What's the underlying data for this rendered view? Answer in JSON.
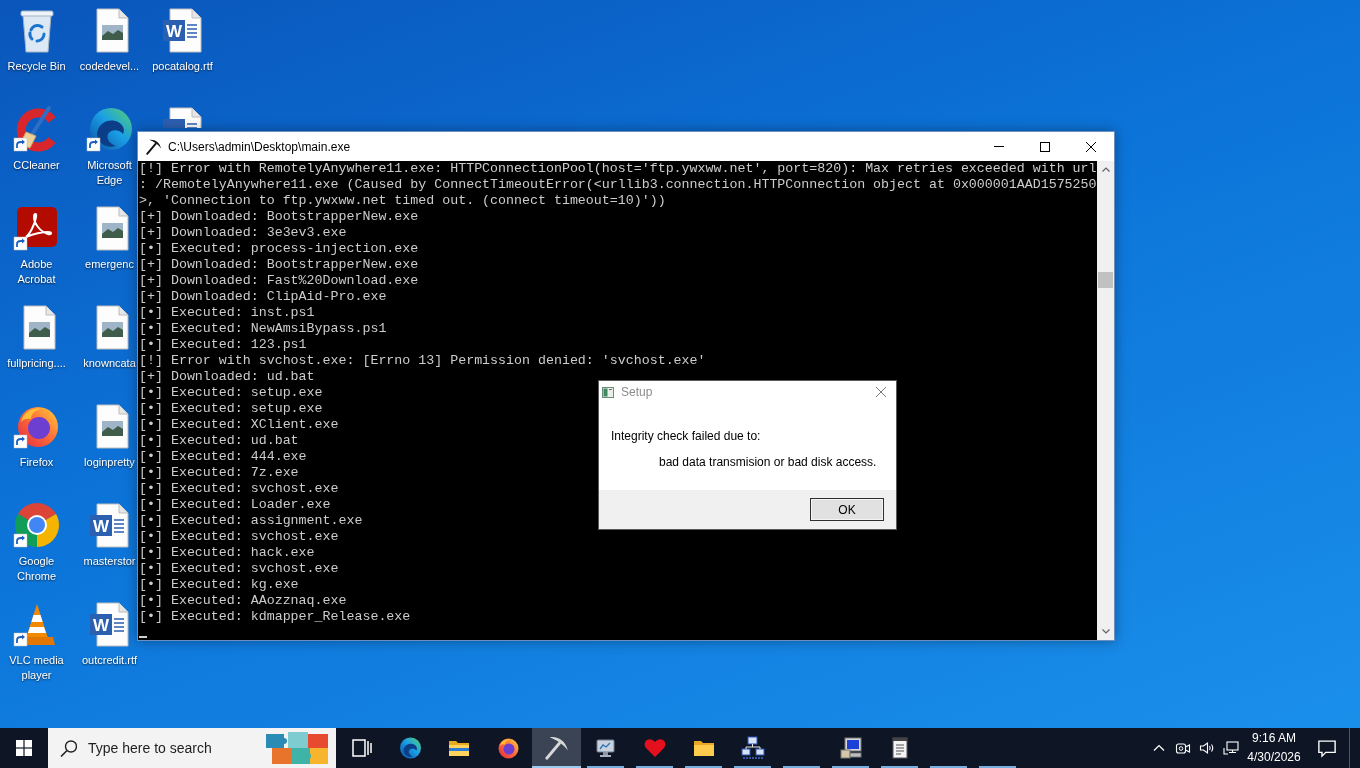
{
  "desktop": {
    "icons": [
      {
        "label": "Recycle Bin",
        "kind": "recycle",
        "shortcut": false
      },
      {
        "label": "CCleaner",
        "kind": "ccleaner",
        "shortcut": true
      },
      {
        "label": "Adobe Acrobat",
        "kind": "acrobat",
        "shortcut": true
      },
      {
        "label": "fullpricing....",
        "kind": "image",
        "shortcut": false
      },
      {
        "label": "Firefox",
        "kind": "firefox",
        "shortcut": true
      },
      {
        "label": "Google Chrome",
        "kind": "chrome",
        "shortcut": true
      },
      {
        "label": "VLC media player",
        "kind": "vlc",
        "shortcut": true
      },
      {
        "label": "codedevel...",
        "kind": "image",
        "shortcut": false
      },
      {
        "label": "Microsoft Edge",
        "kind": "edge",
        "shortcut": true
      },
      {
        "label": "emergenc",
        "kind": "image",
        "shortcut": false
      },
      {
        "label": "knowncata",
        "kind": "image",
        "shortcut": false
      },
      {
        "label": "loginpretty",
        "kind": "image",
        "shortcut": false
      },
      {
        "label": "masterstor",
        "kind": "word",
        "badge": "W",
        "shortcut": false
      },
      {
        "label": "outcredit.rtf",
        "kind": "word",
        "badge": "W",
        "shortcut": false
      },
      {
        "label": "pocatalog.rtf",
        "kind": "word",
        "badge": "W",
        "shortcut": false
      },
      {
        "kind": "word",
        "shortcut": false,
        "covered": true
      }
    ]
  },
  "console": {
    "title": "C:\\Users\\admin\\Desktop\\main.exe",
    "lines": [
      "[!] Error with RemotelyAnywhere11.exe: HTTPConnectionPool(host='ftp.ywxww.net', port=820): Max retries exceeded with url",
      ": /RemotelyAnywhere11.exe (Caused by ConnectTimeoutError(<urllib3.connection.HTTPConnection object at 0x000001AAD1575250",
      ">, 'Connection to ftp.ywxww.net timed out. (connect timeout=10)'))",
      "[+] Downloaded: BootstrapperNew.exe",
      "[+] Downloaded: 3e3ev3.exe",
      "[•] Executed: process-injection.exe",
      "[+] Downloaded: BootstrapperNew.exe",
      "[+] Downloaded: Fast%20Download.exe",
      "[+] Downloaded: ClipAid-Pro.exe",
      "[•] Executed: inst.ps1",
      "[•] Executed: NewAmsiBypass.ps1",
      "[•] Executed: 123.ps1",
      "[!] Error with svchost.exe: [Errno 13] Permission denied: 'svchost.exe'",
      "[+] Downloaded: ud.bat",
      "[•] Executed: setup.exe",
      "[•] Executed: setup.exe",
      "[•] Executed: XClient.exe",
      "[•] Executed: ud.bat",
      "[•] Executed: 444.exe",
      "[•] Executed: 7z.exe",
      "[•] Executed: svchost.exe",
      "[•] Executed: Loader.exe",
      "[•] Executed: assignment.exe",
      "[•] Executed: svchost.exe",
      "[•] Executed: hack.exe",
      "[•] Executed: svchost.exe",
      "[•] Executed: kg.exe",
      "[•] Executed: AAozznaq.exe",
      "[•] Executed: kdmapper_Release.exe"
    ]
  },
  "dialog": {
    "title": "Setup",
    "message": "Integrity check failed due to:",
    "detail": "bad data transmision or bad disk access.",
    "buttons": [
      {
        "label": "OK",
        "default": true
      }
    ]
  },
  "taskbar": {
    "search": {
      "placeholder": "Type here to search"
    },
    "apps": [
      {
        "kind": "taskview",
        "running": false,
        "active": false
      },
      {
        "kind": "edge",
        "running": false,
        "active": false
      },
      {
        "kind": "explorer",
        "running": false,
        "active": false
      },
      {
        "kind": "firefox",
        "running": false,
        "active": false
      },
      {
        "kind": "pickaxe",
        "running": true,
        "active": true
      },
      {
        "kind": "monitor",
        "running": true,
        "active": false
      },
      {
        "kind": "heart",
        "running": true,
        "active": false
      },
      {
        "kind": "folder",
        "running": true,
        "active": false
      },
      {
        "kind": "network",
        "running": true,
        "active": false
      },
      {
        "kind": "blank",
        "running": true,
        "active": false
      },
      {
        "kind": "computer",
        "running": true,
        "active": false
      },
      {
        "kind": "notepad",
        "running": true,
        "active": false
      },
      {
        "kind": "blank",
        "running": true,
        "active": false
      },
      {
        "kind": "blank",
        "running": true,
        "active": false
      }
    ],
    "clock": {
      "time": "9:16 AM",
      "date": "4/30/2026"
    }
  }
}
